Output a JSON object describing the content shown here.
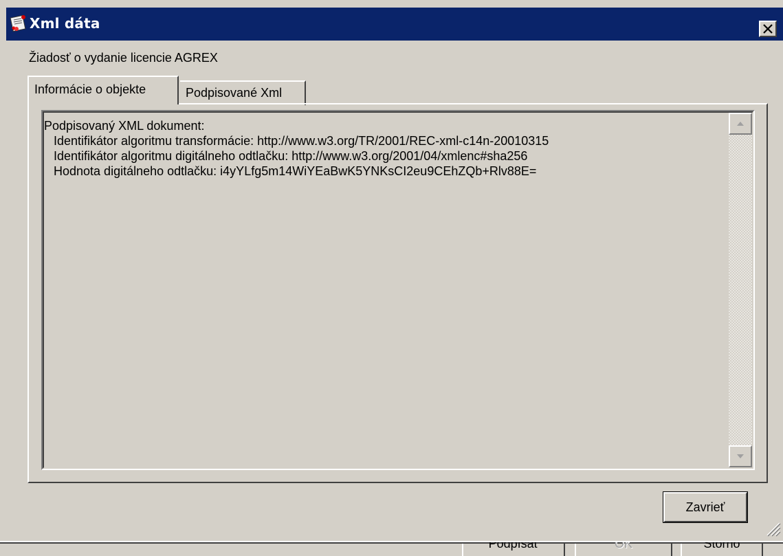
{
  "window": {
    "title": "Xml dáta",
    "title_icon": "certificate-doc-icon",
    "close_icon": "close-icon"
  },
  "subtitle": "Žiadosť o vydanie licencie AGREX",
  "tabs": [
    {
      "label": "Informácie o objekte",
      "active": true
    },
    {
      "label": "Podpisované Xml",
      "active": false
    }
  ],
  "content": {
    "lines": [
      "Podpisovaný XML dokument:",
      "Identifikátor algoritmu transformácie: http://www.w3.org/TR/2001/REC-xml-c14n-20010315",
      "Identifikátor algoritmu digitálneho odtlačku: http://www.w3.org/2001/04/xmlenc#sha256",
      "Hodnota digitálneho odtlačku: i4yYLfg5m14WiYEaBwK5YNKsCI2eu9CEhZQb+Rlv88E="
    ]
  },
  "buttons": {
    "close_label": "Zavrieť"
  },
  "background_buttons": [
    {
      "label": "Podpísať",
      "enabled": true
    },
    {
      "label": "OK",
      "enabled": false
    },
    {
      "label": "Storno",
      "enabled": true
    }
  ],
  "colors": {
    "titlebar": "#0a246a",
    "face": "#d4d0c8"
  }
}
